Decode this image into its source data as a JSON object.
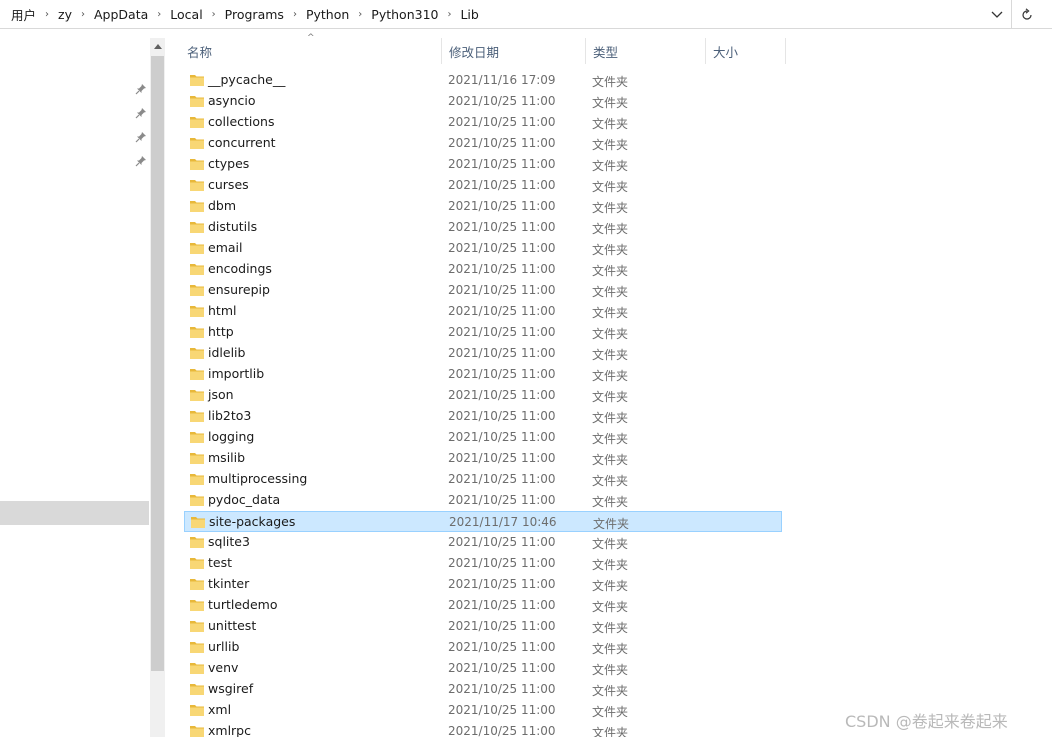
{
  "breadcrumb": [
    "用户",
    "zy",
    "AppData",
    "Local",
    "Programs",
    "Python",
    "Python310",
    "Lib"
  ],
  "breadcrumb_separator": "›",
  "icons": {
    "dropdown": "chevron-down-icon",
    "refresh": "refresh-icon",
    "pin": "pin-icon",
    "folder": "folder-icon",
    "sort": "sort-ascending-icon"
  },
  "colors": {
    "folder": "#f8d775",
    "selected_row_bg": "#cce8ff",
    "selected_row_border": "#99d1ff",
    "nav_selected": "#d9d9d9",
    "header_text": "#4c607a"
  },
  "columns": {
    "name": "名称",
    "date": "修改日期",
    "type": "类型",
    "size": "大小"
  },
  "sort_indicator": "^",
  "files": [
    {
      "name": "__pycache__",
      "date": "2021/11/16 17:09",
      "type": "文件夹"
    },
    {
      "name": "asyncio",
      "date": "2021/10/25 11:00",
      "type": "文件夹"
    },
    {
      "name": "collections",
      "date": "2021/10/25 11:00",
      "type": "文件夹"
    },
    {
      "name": "concurrent",
      "date": "2021/10/25 11:00",
      "type": "文件夹"
    },
    {
      "name": "ctypes",
      "date": "2021/10/25 11:00",
      "type": "文件夹"
    },
    {
      "name": "curses",
      "date": "2021/10/25 11:00",
      "type": "文件夹"
    },
    {
      "name": "dbm",
      "date": "2021/10/25 11:00",
      "type": "文件夹"
    },
    {
      "name": "distutils",
      "date": "2021/10/25 11:00",
      "type": "文件夹"
    },
    {
      "name": "email",
      "date": "2021/10/25 11:00",
      "type": "文件夹"
    },
    {
      "name": "encodings",
      "date": "2021/10/25 11:00",
      "type": "文件夹"
    },
    {
      "name": "ensurepip",
      "date": "2021/10/25 11:00",
      "type": "文件夹"
    },
    {
      "name": "html",
      "date": "2021/10/25 11:00",
      "type": "文件夹"
    },
    {
      "name": "http",
      "date": "2021/10/25 11:00",
      "type": "文件夹"
    },
    {
      "name": "idlelib",
      "date": "2021/10/25 11:00",
      "type": "文件夹"
    },
    {
      "name": "importlib",
      "date": "2021/10/25 11:00",
      "type": "文件夹"
    },
    {
      "name": "json",
      "date": "2021/10/25 11:00",
      "type": "文件夹"
    },
    {
      "name": "lib2to3",
      "date": "2021/10/25 11:00",
      "type": "文件夹"
    },
    {
      "name": "logging",
      "date": "2021/10/25 11:00",
      "type": "文件夹"
    },
    {
      "name": "msilib",
      "date": "2021/10/25 11:00",
      "type": "文件夹"
    },
    {
      "name": "multiprocessing",
      "date": "2021/10/25 11:00",
      "type": "文件夹"
    },
    {
      "name": "pydoc_data",
      "date": "2021/10/25 11:00",
      "type": "文件夹"
    },
    {
      "name": "site-packages",
      "date": "2021/11/17 10:46",
      "type": "文件夹",
      "selected": true
    },
    {
      "name": "sqlite3",
      "date": "2021/10/25 11:00",
      "type": "文件夹"
    },
    {
      "name": "test",
      "date": "2021/10/25 11:00",
      "type": "文件夹"
    },
    {
      "name": "tkinter",
      "date": "2021/10/25 11:00",
      "type": "文件夹"
    },
    {
      "name": "turtledemo",
      "date": "2021/10/25 11:00",
      "type": "文件夹"
    },
    {
      "name": "unittest",
      "date": "2021/10/25 11:00",
      "type": "文件夹"
    },
    {
      "name": "urllib",
      "date": "2021/10/25 11:00",
      "type": "文件夹"
    },
    {
      "name": "venv",
      "date": "2021/10/25 11:00",
      "type": "文件夹"
    },
    {
      "name": "wsgiref",
      "date": "2021/10/25 11:00",
      "type": "文件夹"
    },
    {
      "name": "xml",
      "date": "2021/10/25 11:00",
      "type": "文件夹"
    },
    {
      "name": "xmlrpc",
      "date": "2021/10/25 11:00",
      "type": "文件夹"
    }
  ],
  "watermark": "CSDN @卷起来卷起来"
}
